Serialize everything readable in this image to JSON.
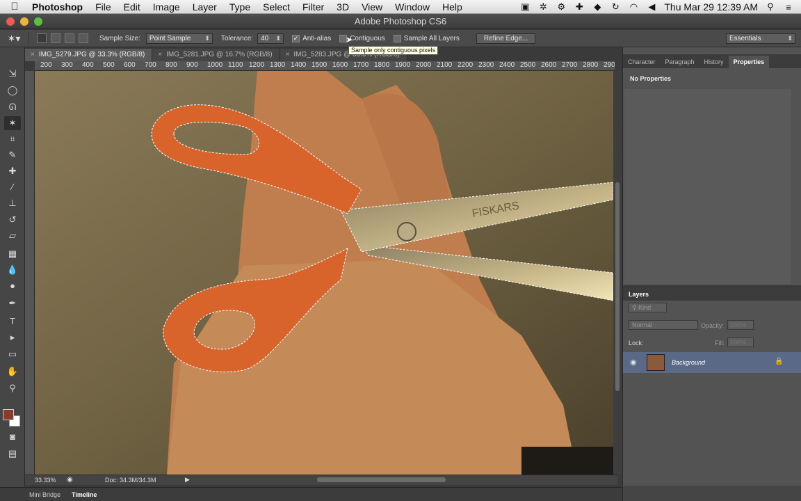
{
  "menubar": {
    "app": "Photoshop",
    "items": [
      "File",
      "Edit",
      "Image",
      "Layer",
      "Type",
      "Select",
      "Filter",
      "3D",
      "View",
      "Window",
      "Help"
    ],
    "clock": "Thu Mar 29  12:39 AM"
  },
  "window": {
    "title": "Adobe Photoshop CS6"
  },
  "options": {
    "sample_size_label": "Sample Size:",
    "sample_size_value": "Point Sample",
    "tolerance_label": "Tolerance:",
    "tolerance_value": "40",
    "anti_alias_label": "Anti-alias",
    "contiguous_label": "Contiguous",
    "sample_all_label": "Sample All Layers",
    "refine_edge_label": "Refine Edge...",
    "workspace_value": "Essentials",
    "tooltip": "Sample only contiguous pixels"
  },
  "doc_tabs": [
    {
      "label": "IMG_5279.JPG @ 33.3% (RGB/8)"
    },
    {
      "label": "IMG_5281.JPG @ 16.7% (RGB/8)"
    },
    {
      "label": "IMG_5283.JPG @ 33.3% (RGB/8)"
    }
  ],
  "ruler_marks": [
    "200",
    "300",
    "400",
    "500",
    "600",
    "700",
    "800",
    "900",
    "1000",
    "1100",
    "1200",
    "1300",
    "1400",
    "1500",
    "1600",
    "1700",
    "1800",
    "1900",
    "2000",
    "2100",
    "2200",
    "2300",
    "2400",
    "2500",
    "2600",
    "2700",
    "2800",
    "290"
  ],
  "canvas": {
    "brand_text": "FISKARS"
  },
  "status": {
    "zoom": "33.33%",
    "doc": "Doc: 34.3M/34.3M"
  },
  "bottom_tabs": [
    "Mini Bridge",
    "Timeline"
  ],
  "properties_panel": {
    "tabs": [
      "Character",
      "Paragraph",
      "History",
      "Properties"
    ],
    "message": "No Properties"
  },
  "layers_panel": {
    "title": "Layers",
    "kind_label": "Kind",
    "blend_mode": "Normal",
    "opacity_label": "Opacity:",
    "opacity_value": "100%",
    "lock_label": "Lock:",
    "fill_label": "Fill:",
    "fill_value": "100%",
    "layers": [
      {
        "name": "Background"
      }
    ]
  },
  "colors": {
    "foreground": "#8a3a2a",
    "background": "#ffffff",
    "selected_layer": "#5a6a86"
  }
}
